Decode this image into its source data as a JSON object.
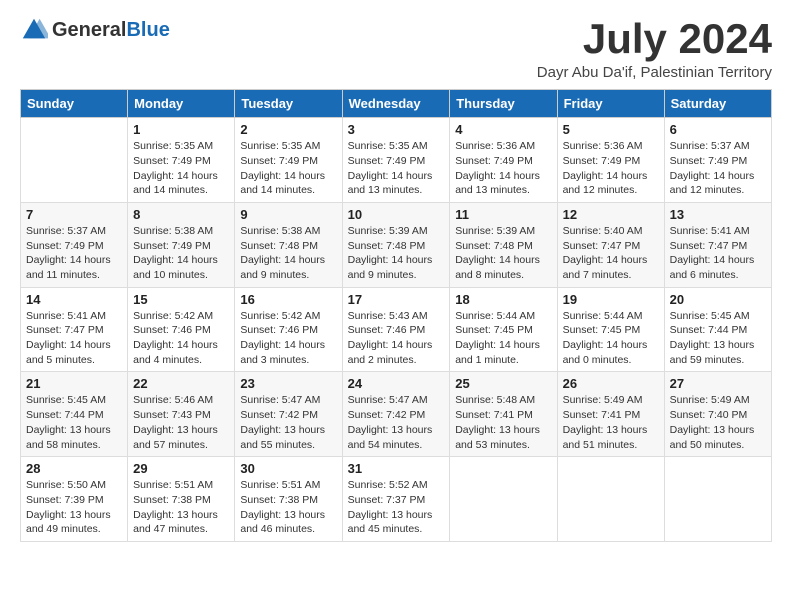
{
  "header": {
    "logo_general": "General",
    "logo_blue": "Blue",
    "month": "July 2024",
    "location": "Dayr Abu Da'if, Palestinian Territory"
  },
  "weekdays": [
    "Sunday",
    "Monday",
    "Tuesday",
    "Wednesday",
    "Thursday",
    "Friday",
    "Saturday"
  ],
  "weeks": [
    [
      {
        "day": "",
        "info": ""
      },
      {
        "day": "1",
        "info": "Sunrise: 5:35 AM\nSunset: 7:49 PM\nDaylight: 14 hours\nand 14 minutes."
      },
      {
        "day": "2",
        "info": "Sunrise: 5:35 AM\nSunset: 7:49 PM\nDaylight: 14 hours\nand 14 minutes."
      },
      {
        "day": "3",
        "info": "Sunrise: 5:35 AM\nSunset: 7:49 PM\nDaylight: 14 hours\nand 13 minutes."
      },
      {
        "day": "4",
        "info": "Sunrise: 5:36 AM\nSunset: 7:49 PM\nDaylight: 14 hours\nand 13 minutes."
      },
      {
        "day": "5",
        "info": "Sunrise: 5:36 AM\nSunset: 7:49 PM\nDaylight: 14 hours\nand 12 minutes."
      },
      {
        "day": "6",
        "info": "Sunrise: 5:37 AM\nSunset: 7:49 PM\nDaylight: 14 hours\nand 12 minutes."
      }
    ],
    [
      {
        "day": "7",
        "info": "Sunrise: 5:37 AM\nSunset: 7:49 PM\nDaylight: 14 hours\nand 11 minutes."
      },
      {
        "day": "8",
        "info": "Sunrise: 5:38 AM\nSunset: 7:49 PM\nDaylight: 14 hours\nand 10 minutes."
      },
      {
        "day": "9",
        "info": "Sunrise: 5:38 AM\nSunset: 7:48 PM\nDaylight: 14 hours\nand 9 minutes."
      },
      {
        "day": "10",
        "info": "Sunrise: 5:39 AM\nSunset: 7:48 PM\nDaylight: 14 hours\nand 9 minutes."
      },
      {
        "day": "11",
        "info": "Sunrise: 5:39 AM\nSunset: 7:48 PM\nDaylight: 14 hours\nand 8 minutes."
      },
      {
        "day": "12",
        "info": "Sunrise: 5:40 AM\nSunset: 7:47 PM\nDaylight: 14 hours\nand 7 minutes."
      },
      {
        "day": "13",
        "info": "Sunrise: 5:41 AM\nSunset: 7:47 PM\nDaylight: 14 hours\nand 6 minutes."
      }
    ],
    [
      {
        "day": "14",
        "info": "Sunrise: 5:41 AM\nSunset: 7:47 PM\nDaylight: 14 hours\nand 5 minutes."
      },
      {
        "day": "15",
        "info": "Sunrise: 5:42 AM\nSunset: 7:46 PM\nDaylight: 14 hours\nand 4 minutes."
      },
      {
        "day": "16",
        "info": "Sunrise: 5:42 AM\nSunset: 7:46 PM\nDaylight: 14 hours\nand 3 minutes."
      },
      {
        "day": "17",
        "info": "Sunrise: 5:43 AM\nSunset: 7:46 PM\nDaylight: 14 hours\nand 2 minutes."
      },
      {
        "day": "18",
        "info": "Sunrise: 5:44 AM\nSunset: 7:45 PM\nDaylight: 14 hours\nand 1 minute."
      },
      {
        "day": "19",
        "info": "Sunrise: 5:44 AM\nSunset: 7:45 PM\nDaylight: 14 hours\nand 0 minutes."
      },
      {
        "day": "20",
        "info": "Sunrise: 5:45 AM\nSunset: 7:44 PM\nDaylight: 13 hours\nand 59 minutes."
      }
    ],
    [
      {
        "day": "21",
        "info": "Sunrise: 5:45 AM\nSunset: 7:44 PM\nDaylight: 13 hours\nand 58 minutes."
      },
      {
        "day": "22",
        "info": "Sunrise: 5:46 AM\nSunset: 7:43 PM\nDaylight: 13 hours\nand 57 minutes."
      },
      {
        "day": "23",
        "info": "Sunrise: 5:47 AM\nSunset: 7:42 PM\nDaylight: 13 hours\nand 55 minutes."
      },
      {
        "day": "24",
        "info": "Sunrise: 5:47 AM\nSunset: 7:42 PM\nDaylight: 13 hours\nand 54 minutes."
      },
      {
        "day": "25",
        "info": "Sunrise: 5:48 AM\nSunset: 7:41 PM\nDaylight: 13 hours\nand 53 minutes."
      },
      {
        "day": "26",
        "info": "Sunrise: 5:49 AM\nSunset: 7:41 PM\nDaylight: 13 hours\nand 51 minutes."
      },
      {
        "day": "27",
        "info": "Sunrise: 5:49 AM\nSunset: 7:40 PM\nDaylight: 13 hours\nand 50 minutes."
      }
    ],
    [
      {
        "day": "28",
        "info": "Sunrise: 5:50 AM\nSunset: 7:39 PM\nDaylight: 13 hours\nand 49 minutes."
      },
      {
        "day": "29",
        "info": "Sunrise: 5:51 AM\nSunset: 7:38 PM\nDaylight: 13 hours\nand 47 minutes."
      },
      {
        "day": "30",
        "info": "Sunrise: 5:51 AM\nSunset: 7:38 PM\nDaylight: 13 hours\nand 46 minutes."
      },
      {
        "day": "31",
        "info": "Sunrise: 5:52 AM\nSunset: 7:37 PM\nDaylight: 13 hours\nand 45 minutes."
      },
      {
        "day": "",
        "info": ""
      },
      {
        "day": "",
        "info": ""
      },
      {
        "day": "",
        "info": ""
      }
    ]
  ]
}
